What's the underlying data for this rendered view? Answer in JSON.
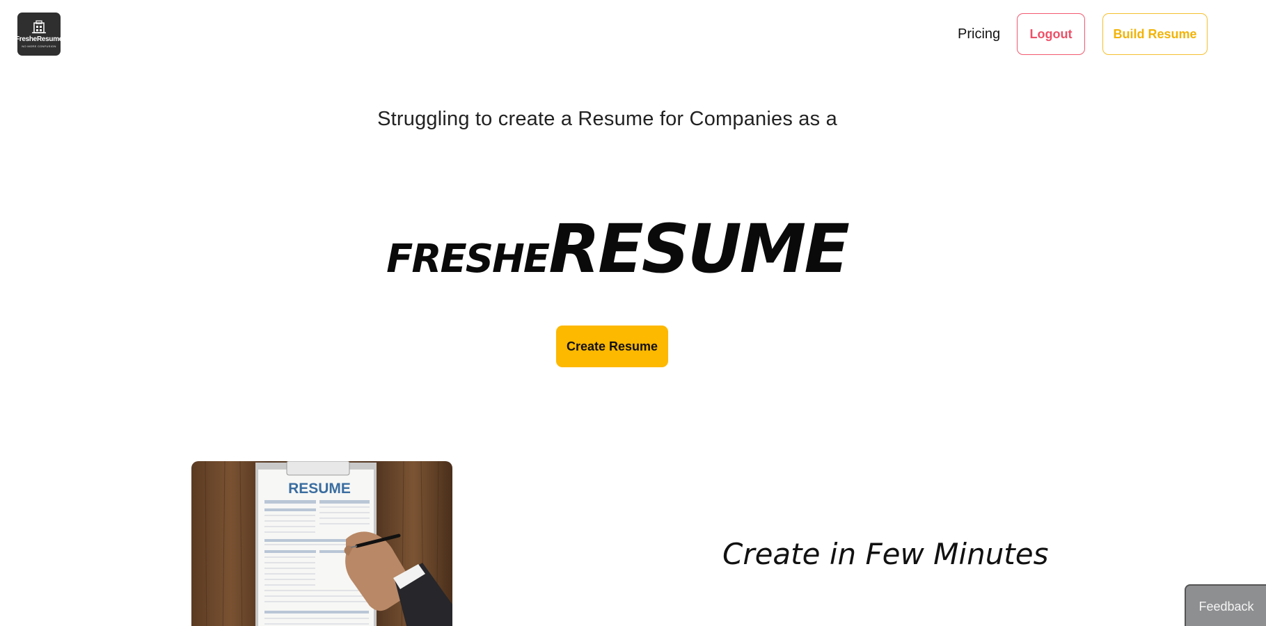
{
  "header": {
    "logo": {
      "word": "FresheResume",
      "tagline": "NO MORE CONFUSION"
    },
    "nav": {
      "pricing_label": "Pricing",
      "logout_label": "Logout",
      "build_label": "Build Resume"
    }
  },
  "hero": {
    "subtitle": "Struggling to create a Resume for Companies as a",
    "brand_small": "FRESHE",
    "brand_big": "RESUME",
    "cta_label": "Create Resume"
  },
  "feature": {
    "title": "Create in Few Minutes",
    "image_heading": "RESUME"
  },
  "feedback_label": "Feedback",
  "colors": {
    "accent_yellow": "#fdb800",
    "logout_red": "#ee4f67",
    "feedback_gray": "#8e8f91"
  }
}
